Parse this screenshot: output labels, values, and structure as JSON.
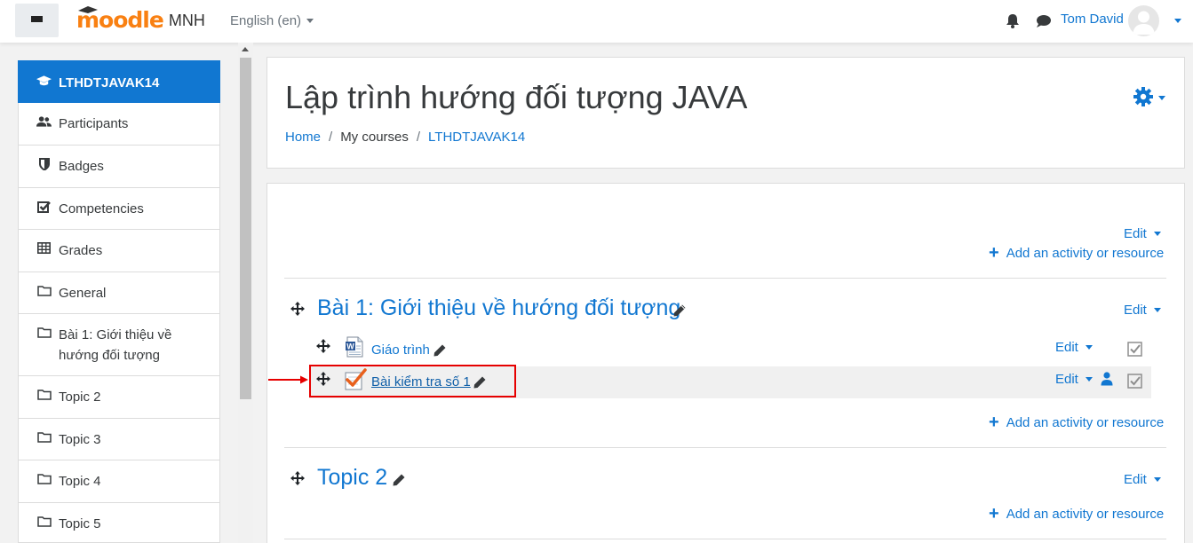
{
  "navbar": {
    "logo_text": "moodle",
    "site_name": "MNH",
    "language": "English (en)",
    "user_name": "Tom David",
    "icons": [
      "menu-icon",
      "bell-icon",
      "chat-icon",
      "avatar"
    ]
  },
  "drawer": {
    "items": [
      {
        "label": "LTHDTJAVAK14",
        "icon": "graduation-cap-icon",
        "active": true
      },
      {
        "label": "Participants",
        "icon": "users-icon"
      },
      {
        "label": "Badges",
        "icon": "shield-icon"
      },
      {
        "label": "Competencies",
        "icon": "checkbox-icon"
      },
      {
        "label": "Grades",
        "icon": "table-icon"
      },
      {
        "label": "General",
        "icon": "folder-icon"
      },
      {
        "label": "Bài 1: Giới thiệu về hướng đối tượng",
        "icon": "folder-icon"
      },
      {
        "label": "Topic 2",
        "icon": "folder-icon"
      },
      {
        "label": "Topic 3",
        "icon": "folder-icon"
      },
      {
        "label": "Topic 4",
        "icon": "folder-icon"
      },
      {
        "label": "Topic 5",
        "icon": "folder-icon"
      }
    ]
  },
  "header": {
    "title": "Lập trình hướng đối tượng JAVA",
    "breadcrumb": [
      "Home",
      "My courses",
      "LTHDTJAVAK14"
    ]
  },
  "course": {
    "general": {
      "edit": "Edit",
      "add": "Add an activity or resource"
    },
    "section1": {
      "title": "Bài 1: Giới thiệu về hướng đối tượng",
      "edit": "Edit",
      "activities": [
        {
          "name": "Giáo trình",
          "edit": "Edit",
          "icon": "word-document-icon"
        },
        {
          "name": "Bài kiểm tra số 1",
          "edit": "Edit",
          "icon": "quiz-icon"
        }
      ],
      "add": "Add an activity or resource"
    },
    "section2": {
      "title": "Topic 2",
      "edit": "Edit",
      "add": "Add an activity or resource"
    }
  },
  "colors": {
    "accent": "#1177d1",
    "brand": "#f98012",
    "highlight": "#e60000"
  }
}
